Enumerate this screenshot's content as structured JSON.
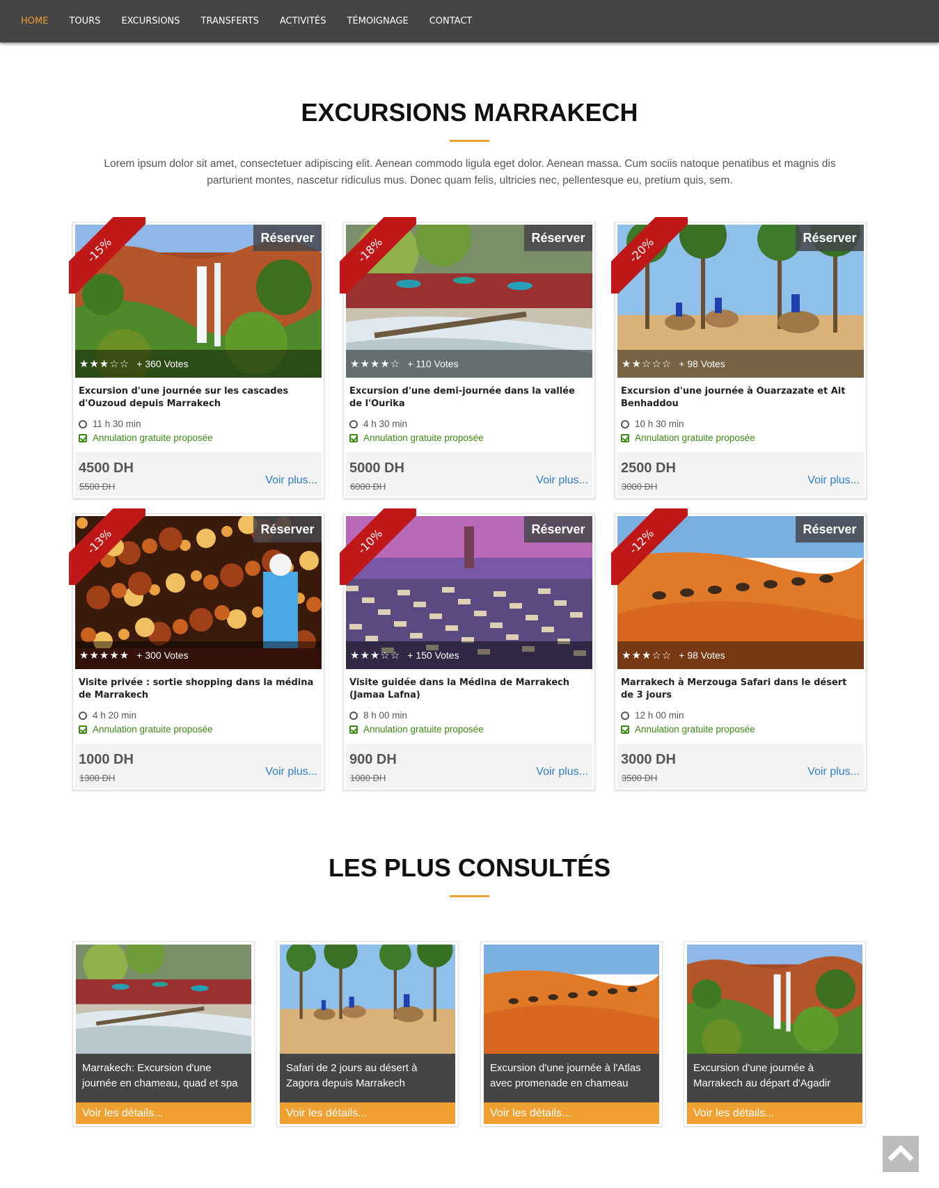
{
  "nav": [
    "HOME",
    "TOURS",
    "EXCURSIONS",
    "TRANSFERTS",
    "ACTIVITÉS",
    "TÉMOIGNAGE",
    "CONTACT"
  ],
  "section1": {
    "title": "EXCURSIONS MARRAKECH",
    "intro": "Lorem ipsum dolor sit amet, consectetuer adipiscing elit. Aenean commodo ligula eget dolor. Aenean massa. Cum sociis natoque penatibus et magnis dis parturient montes, nascetur ridiculus mus. Donec quam felis, ultricies nec, pellentesque eu, pretium quis, sem."
  },
  "cards": [
    {
      "discount": "-15%",
      "reserve": "Réserver",
      "stars": "★★★☆☆",
      "votes": "+ 360 Votes",
      "title": "Excursion d'une journée sur les cascades d'Ouzoud depuis Marrakech",
      "duration": "11 h 30 min",
      "cancel": "Annulation gratuite proposée",
      "price": "4500 DH",
      "old_price": "5500 DH",
      "more": "Voir plus...",
      "image": "waterfall"
    },
    {
      "discount": "-18%",
      "reserve": "Réserver",
      "stars": "★★★★☆",
      "votes": "+ 110 Votes",
      "title": "Excursion d'une demi-journée dans la vallée de l'Ourika",
      "duration": "4 h 30 min",
      "cancel": "Annulation gratuite proposée",
      "price": "5000 DH",
      "old_price": "6000 DH",
      "more": "Voir plus...",
      "image": "river"
    },
    {
      "discount": "-20%",
      "reserve": "Réserver",
      "stars": "★★☆☆☆",
      "votes": "+ 98 Votes",
      "title": "Excursion d'une journée à Ouarzazate et Ait Benhaddou",
      "duration": "10 h 30 min",
      "cancel": "Annulation gratuite proposée",
      "price": "2500 DH",
      "old_price": "3000 DH",
      "more": "Voir plus...",
      "image": "palms"
    },
    {
      "discount": "-13%",
      "reserve": "Réserver",
      "stars": "★★★★★",
      "votes": "+ 300 Votes",
      "title": "Visite privée : sortie shopping dans la médina de Marrakech",
      "duration": "4 h 20 min",
      "cancel": "Annulation gratuite proposée",
      "price": "1000 DH",
      "old_price": "1300 DH",
      "more": "Voir plus...",
      "image": "lamps"
    },
    {
      "discount": "-10%",
      "reserve": "Réserver",
      "stars": "★★★☆☆",
      "votes": "+ 150 Votes",
      "title": "Visite guidée dans la Médina de Marrakech (Jamaa Lafna)",
      "duration": "8 h 00 min",
      "cancel": "Annulation gratuite proposée",
      "price": "900 DH",
      "old_price": "1000 DH",
      "more": "Voir plus...",
      "image": "square"
    },
    {
      "discount": "-12%",
      "reserve": "Réserver",
      "stars": "★★★☆☆",
      "votes": "+ 98 Votes",
      "title": "Marrakech à Merzouga Safari dans le désert de 3 jours",
      "duration": "12 h 00 min",
      "cancel": "Annulation gratuite proposée",
      "price": "3000 DH",
      "old_price": "3500 DH",
      "more": "Voir plus...",
      "image": "desert"
    }
  ],
  "section2": {
    "title": "LES PLUS CONSULTÉS"
  },
  "popular": [
    {
      "caption": "Marrakech: Excursion d'une journée en chameau, quad et spa",
      "button": "Voir les détails...",
      "image": "river"
    },
    {
      "caption": "Safari de 2 jours au désert à Zagora depuis Marrakech",
      "button": "Voir les détails...",
      "image": "palms"
    },
    {
      "caption": "Excursion d'une journée à l'Atlas avec promenade en chameau",
      "button": "Voir les détails...",
      "image": "desert"
    },
    {
      "caption": "Excursion d'une journée à Marrakech au départ d'Agadir",
      "button": "Voir les détails...",
      "image": "waterfall"
    }
  ],
  "colors": {
    "accent": "#f0a030",
    "nav_bg": "#454545",
    "ribbon": "#c01818",
    "link": "#2d7dc8",
    "success": "#3a8a10"
  },
  "icons": {
    "clock": "clock-icon",
    "check": "check-square-icon",
    "totop": "chevron-up-icon"
  }
}
